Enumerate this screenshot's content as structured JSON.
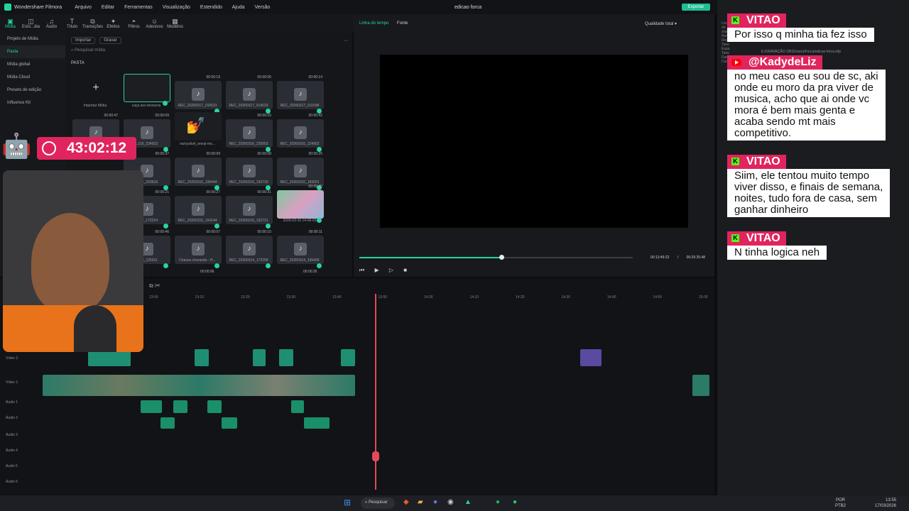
{
  "titlebar": {
    "app": "Wondershare Filmora",
    "menus": [
      "Arquivo",
      "Editar",
      "Ferramentas",
      "Visualização",
      "Estendido",
      "Ajuda",
      "Versão"
    ],
    "project": "edicao forca",
    "export": "Exportar"
  },
  "toolbar": [
    "Mídia",
    "Esto...dia",
    "Áudio",
    "Título",
    "Transições",
    "Efeitos",
    "Filtros",
    "Adesivos",
    "Modelos"
  ],
  "leftnav": [
    "Projeto de Mídia",
    "Pasta",
    "Mídia global",
    "Mídia Cloud",
    "Presets de edição",
    "Influence Kit"
  ],
  "media": {
    "import_label": "Importar",
    "record_label": "Gravar",
    "search_placeholder": "Pesquisar mídia",
    "folder_label": "PASTA",
    "import_tile": "Importar Mídia",
    "row1": [
      {
        "name": "caça aos tesouros",
        "dur": ""
      },
      {
        "name": "REC_20260317_015631",
        "dur": "00:00:19"
      },
      {
        "name": "REC_20260317_014033",
        "dur": "00:00:06"
      },
      {
        "name": "REC_20260317_011508",
        "dur": "00:00:14"
      }
    ],
    "row2": [
      {
        "name": "...316_234933",
        "dur": "00:00:09"
      },
      {
        "name": "nail-polish_emoji-mo...",
        "dur": ""
      },
      {
        "name": "REC_20260316_225903",
        "dur": "00:00:16"
      },
      {
        "name": "REC_20260316_224902",
        "dur": "00:00:42"
      }
    ],
    "row2_first_dur": "00:00:47",
    "row3": [
      {
        "name": "...316_203618",
        "dur": "00:00:37"
      },
      {
        "name": "REC_20260316_195444",
        "dur": "00:00:09"
      },
      {
        "name": "REC_20260316_193730",
        "dur": "00:00:08"
      },
      {
        "name": "REC_20260316_183001",
        "dur": "00:00:25"
      }
    ],
    "row4": [
      {
        "name": "...316_172224",
        "dur": "00:00:21"
      },
      {
        "name": "REC_20260316_164144",
        "dur": "00:00:27"
      },
      {
        "name": "REC_20260316_152721",
        "dur": "00:00:31"
      },
      {
        "name": "2026-03-16 14-06-03",
        "dur": "00:00:40"
      }
    ],
    "row5": [
      {
        "name": "...316_125911",
        "dur": "00:00:46"
      },
      {
        "name": "Chaves chorando - H...",
        "dur": "00:00:07"
      },
      {
        "name": "REC_20260314_172258",
        "dur": "00:00:10"
      },
      {
        "name": "REC_20260314_165409",
        "dur": "00:00:11"
      }
    ],
    "row6_durs": [
      "00:00:06",
      "00:00:26"
    ]
  },
  "preview": {
    "tab_timeline": "Linha do tempo",
    "tab_source": "Fonte",
    "quality": "Qualidade total",
    "current_time": "00:13:49:22",
    "separator": "/",
    "total_time": "00:26:25:48",
    "progress": 0.52
  },
  "timeline": {
    "ruler": [
      "13:00",
      "13:10",
      "13:20",
      "13:30",
      "13:40",
      "13:50",
      "14:00",
      "14:10",
      "14:20",
      "14:30",
      "14:40",
      "14:50",
      "15:00"
    ],
    "tracks": [
      "Vídeo 2",
      "Vídeo 1",
      "Áudio 1",
      "Áudio 2",
      "Áudio 3",
      "Áudio 4",
      "Áudio 5",
      "Áudio 6"
    ]
  },
  "timer": "43:02:12",
  "chat": {
    "side_labels": [
      "Local do",
      "arquivo",
      "Nom",
      "Res",
      "Taxa",
      "Espa",
      "Taxa",
      "Dur",
      "Cana"
    ],
    "file_path": "E:/GRAVAÇÃO OBS/Users/Forca/edicao forca.wfp",
    "messages": [
      {
        "user": "VITAO",
        "platform": "kick",
        "lines": [
          "Por isso q minha tia fez isso"
        ]
      },
      {
        "user": "@KadydeLiz",
        "platform": "youtube",
        "lines": [
          "no meu caso eu sou de sc, aki",
          "onde eu moro da pra viver de",
          "musica, acho que ai onde vc",
          "mora é bem mais genta e",
          "acaba sendo mt mais",
          "competitivo."
        ]
      },
      {
        "user": "VITAO",
        "platform": "kick",
        "lines": [
          "Siim, ele tentou muito tempo",
          "viver disso, e finais de semana,",
          "noites, tudo fora de casa, sem",
          "ganhar dinheiro"
        ]
      },
      {
        "user": "VITAO",
        "platform": "kick",
        "lines": [
          "N tinha logica neh"
        ]
      }
    ]
  },
  "taskbar": {
    "search": "Pesquisar",
    "lang": "POR",
    "layout": "PTB2",
    "time": "13:55",
    "date": "17/03/2026"
  }
}
